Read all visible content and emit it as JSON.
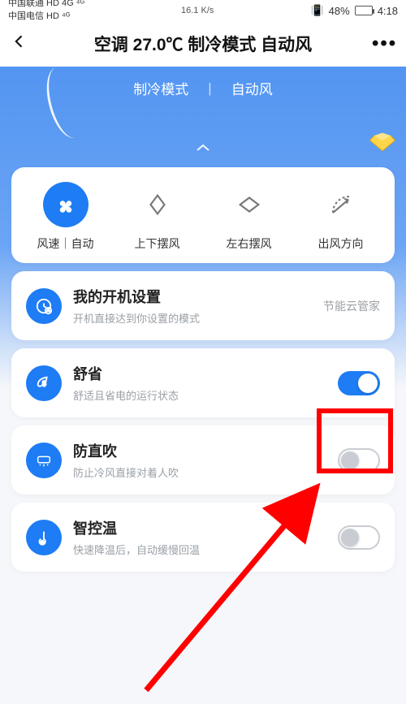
{
  "status": {
    "carrier1": "中国联通 HD 4G ⁴ᴳ",
    "carrier2": "中国电信 HD ⁴ᴳ",
    "net": "16.1 K/s",
    "battery": "48%",
    "time": "4:18"
  },
  "header": {
    "title": "空调 27.0℃ 制冷模式 自动风"
  },
  "subtabs": {
    "mode": "制冷模式",
    "wind": "自动风"
  },
  "controls": [
    {
      "name": "fan-speed",
      "label": "风速｜自动",
      "icon": "fan",
      "active": true
    },
    {
      "name": "swing-ud",
      "label": "上下摆风",
      "icon": "swing-ud",
      "active": false
    },
    {
      "name": "swing-lr",
      "label": "左右摆风",
      "icon": "swing-lr",
      "active": false
    },
    {
      "name": "direction",
      "label": "出风方向",
      "icon": "angle",
      "active": false
    }
  ],
  "settings": {
    "startup": {
      "title": "我的开机设置",
      "sub": "开机直接达到你设置的模式",
      "trailing": "节能云管家"
    },
    "eco": {
      "title": "舒省",
      "sub": "舒适且省电的运行状态",
      "on": true
    },
    "anti_direct": {
      "title": "防直吹",
      "sub": "防止冷风直接对着人吹",
      "on": false
    },
    "smart_temp": {
      "title": "智控温",
      "sub": "快速降温后，自动缓慢回温",
      "on": false
    }
  }
}
